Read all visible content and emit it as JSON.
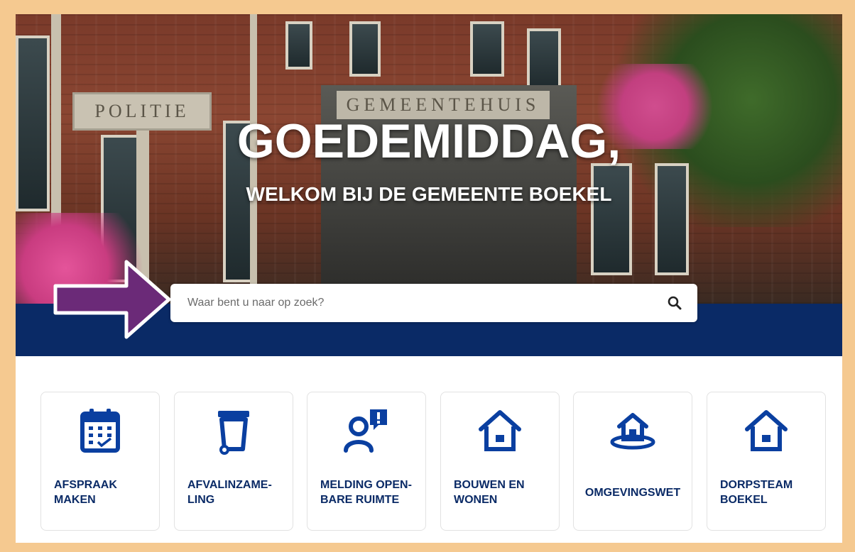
{
  "hero": {
    "title": "GOEDEMIDDAG,",
    "subtitle": "WELKOM BIJ DE GEMEENTE BOEKEL",
    "photo_signs": {
      "politie": "POLITIE",
      "gemeentehuis": "GEMEENTEHUIS"
    }
  },
  "search": {
    "placeholder": "Waar bent u naar op zoek?",
    "icon": "search-icon"
  },
  "annotation": {
    "arrow_color": "#6b2a78",
    "arrow_icon": "arrow-right-icon"
  },
  "colors": {
    "navy": "#0a2a66",
    "frame": "#f5c990"
  },
  "tiles": [
    {
      "line1": "AFSPRAAK",
      "line2": "MAKEN",
      "icon": "calendar-icon"
    },
    {
      "line1": "AFVALINZAME-",
      "line2": "LING",
      "icon": "waste-bin-icon"
    },
    {
      "line1": "MELDING OPEN-",
      "line2": "BARE RUIMTE",
      "icon": "person-alert-icon"
    },
    {
      "line1": "BOUWEN EN",
      "line2": "WONEN",
      "icon": "house-icon"
    },
    {
      "line1": "OMGEVINGSWET",
      "line2": "",
      "icon": "house-on-ground-icon"
    },
    {
      "line1": "DORPSTEAM",
      "line2": "BOEKEL",
      "icon": "house-icon"
    }
  ]
}
